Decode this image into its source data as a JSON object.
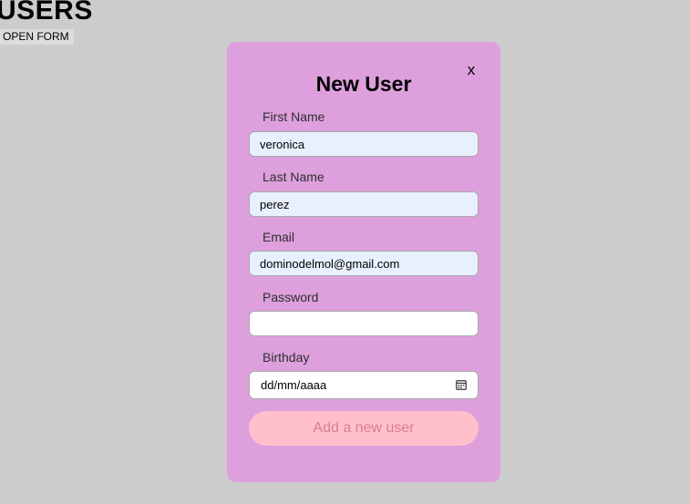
{
  "header": {
    "title": "USERS",
    "open_form_label": "OPEN FORM"
  },
  "modal": {
    "close_label": "x",
    "title": "New User",
    "fields": {
      "first_name": {
        "label": "First Name",
        "value": "veronica"
      },
      "last_name": {
        "label": "Last Name",
        "value": "perez"
      },
      "email": {
        "label": "Email",
        "value": "dominodelmol@gmail.com"
      },
      "password": {
        "label": "Password",
        "value": ""
      },
      "birthday": {
        "label": "Birthday",
        "placeholder": "dd/mm/aaaa",
        "icon": "calendar-icon"
      }
    },
    "submit_label": "Add a new user"
  },
  "colors": {
    "page_background": "#cccccc",
    "modal_background": "#dda0dd",
    "autofill_background": "#e8f0fe",
    "submit_background": "#ffc0cb",
    "submit_text": "#db7b98"
  }
}
